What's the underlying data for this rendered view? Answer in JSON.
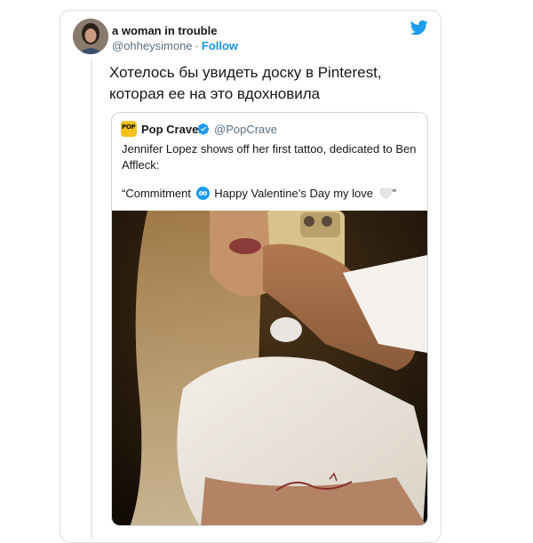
{
  "tweet": {
    "author_name": "a woman in trouble",
    "author_handle": "@ohheysimone",
    "separator": "·",
    "follow_label": "Follow",
    "text_line1": "Хотелось бы увидеть доску в Pinterest,",
    "text_line2": "которая ее на это вдохновила"
  },
  "quoted_tweet": {
    "author_name": "Pop Crave",
    "author_handle": "@PopCrave",
    "avatar_text": "POP",
    "text": "Jennifer Lopez shows off her first tattoo, dedicated to Ben Affleck:",
    "quote_before_icon": "“Commitment",
    "quote_after_icon": "Happy Valentine’s Day my love",
    "quote_close": "”"
  },
  "icons": {
    "brand": "twitter-bird-icon",
    "verified": "verified-badge-icon",
    "infinity": "infinity-icon",
    "heart": "white-heart-icon"
  },
  "colors": {
    "accent": "#1b95e0",
    "text": "#14171a",
    "muted": "#5b7083",
    "border": "#cfd9de"
  }
}
